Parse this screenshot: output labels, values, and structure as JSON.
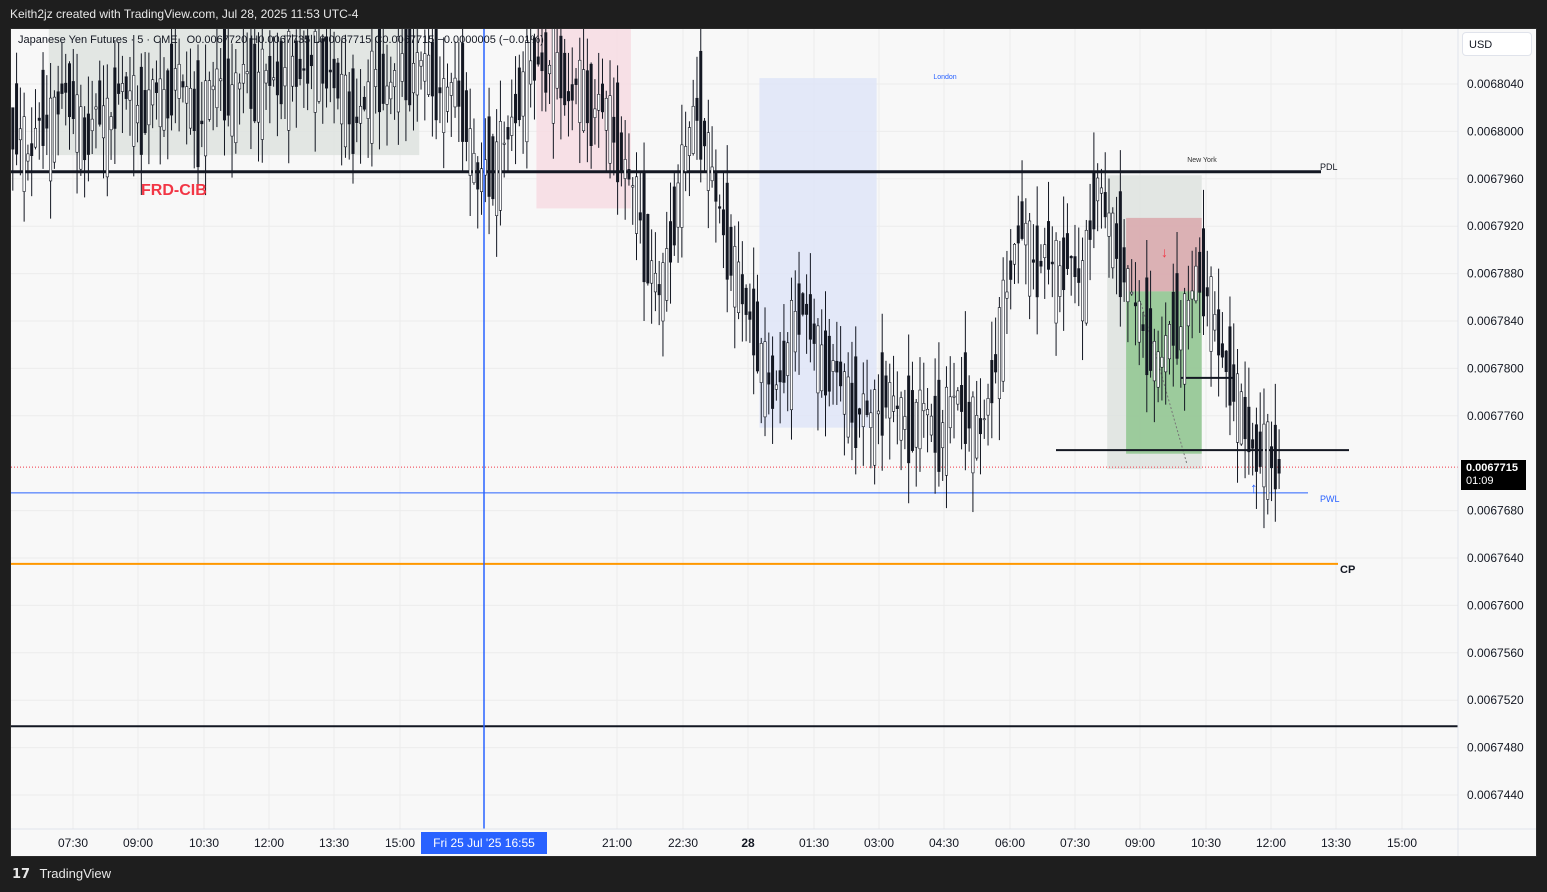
{
  "header": {
    "title": "Keith2jz created with TradingView.com, Jul 28, 2025 11:53 UTC-4"
  },
  "footer": {
    "brand": "TradingView"
  },
  "toolbar": {
    "currency": "USD"
  },
  "legend": {
    "symbol": "Japanese Yen Futures · 5 · CME",
    "ohlc": "O0.0067720 H0.0067735 L0.0067715 C0.0067715 −0.0000005 (−0.01%)"
  },
  "annotations": {
    "frd_label": "FRD-CIB",
    "london_label": "London",
    "newyork_label": "New York",
    "pdl_label": "PDL",
    "pwl_label": "PWL",
    "cp_label": "CP"
  },
  "price_tag": {
    "price": "0.0067715",
    "countdown": "01:09"
  },
  "crosshair_time": "Fri 25 Jul '25   16:55",
  "colors": {
    "pink_zone": "#f6dde3",
    "gray_zone": "#dfe3e0",
    "blue_zone": "#e0e6f7",
    "stop_zone": "#d9a7ab",
    "target_zone": "#8fc68f",
    "cp_line": "#ff9800",
    "pwl_line": "#2962ff",
    "frd_text": "#f23645"
  },
  "chart_data": {
    "type": "candlestick",
    "symbol": "Japanese Yen Futures",
    "interval": "5",
    "exchange": "CME",
    "ylim": [
      0.00674,
      0.006808
    ],
    "y_ticks": [
      "0.0068040",
      "0.0068000",
      "0.0067960",
      "0.0067920",
      "0.0067880",
      "0.0067840",
      "0.0067800",
      "0.0067760",
      "0.0067680",
      "0.0067640",
      "0.0067600",
      "0.0067560",
      "0.0067520",
      "0.0067480",
      "0.0067440"
    ],
    "x_ticks": [
      "07:30",
      "09:00",
      "10:30",
      "12:00",
      "13:30",
      "15:00",
      "21:00",
      "22:30",
      "28",
      "01:30",
      "03:00",
      "04:30",
      "06:00",
      "07:30",
      "09:00",
      "10:30",
      "12:00",
      "13:30",
      "15:00"
    ],
    "last_price": 0.0067715,
    "levels": [
      {
        "name": "PDL",
        "price": 0.0067966
      },
      {
        "name": "PWL",
        "price": 0.0067695
      },
      {
        "name": "CP",
        "price": 0.0067635
      },
      {
        "name": "",
        "price": 0.0067498
      },
      {
        "name": "",
        "price": 0.0067731
      }
    ],
    "series_path": [
      [
        0,
        0.0067995
      ],
      [
        2,
        0.0068005
      ],
      [
        5,
        0.0067975
      ],
      [
        8,
        0.0068015
      ],
      [
        11,
        0.0068
      ],
      [
        14,
        0.006804
      ],
      [
        17,
        0.006802
      ],
      [
        20,
        0.0067985
      ],
      [
        23,
        0.0068025
      ],
      [
        26,
        0.0068
      ],
      [
        29,
        0.006804
      ],
      [
        32,
        0.006803
      ],
      [
        35,
        0.0068005
      ],
      [
        38,
        0.006804
      ],
      [
        41,
        0.006802
      ],
      [
        44,
        0.006805
      ],
      [
        47,
        0.006803
      ],
      [
        50,
        0.0068
      ],
      [
        53,
        0.0068035
      ],
      [
        56,
        0.0068045
      ],
      [
        59,
        0.006802
      ],
      [
        62,
        0.0068055
      ],
      [
        65,
        0.006803
      ],
      [
        68,
        0.006805
      ],
      [
        71,
        0.006804
      ],
      [
        74,
        0.0068055
      ],
      [
        77,
        0.006805
      ],
      [
        80,
        0.006806
      ],
      [
        85,
        0.006805
      ],
      [
        88,
        0.006803
      ],
      [
        91,
        0.0068005
      ],
      [
        94,
        0.0068025
      ],
      [
        97,
        0.006805
      ],
      [
        100,
        0.006803
      ],
      [
        103,
        0.006806
      ],
      [
        106,
        0.0068045
      ],
      [
        109,
        0.006806
      ],
      [
        112,
        0.0068045
      ],
      [
        115,
        0.0068025
      ],
      [
        117,
        0.006804
      ],
      [
        120,
        0.006802
      ],
      [
        122,
        0.006798
      ],
      [
        124,
        0.0067955
      ],
      [
        126,
        0.0067975
      ],
      [
        128,
        0.006796
      ],
      [
        130,
        0.0067985
      ],
      [
        132,
        0.0068
      ],
      [
        134,
        0.006802
      ],
      [
        136,
        0.006804
      ],
      [
        138,
        0.0068055
      ],
      [
        140,
        0.006806
      ],
      [
        142,
        0.006805
      ],
      [
        144,
        0.006806
      ],
      [
        146,
        0.0068045
      ],
      [
        148,
        0.0068025
      ],
      [
        150,
        0.0068045
      ],
      [
        152,
        0.006803
      ],
      [
        154,
        0.006801
      ],
      [
        156,
        0.006803
      ],
      [
        158,
        0.0068015
      ],
      [
        160,
        0.0067995
      ],
      [
        162,
        0.0067975
      ],
      [
        164,
        0.006796
      ],
      [
        166,
        0.006794
      ],
      [
        168,
        0.00679
      ],
      [
        170,
        0.006788
      ],
      [
        172,
        0.0067862
      ],
      [
        174,
        0.006789
      ],
      [
        176,
        0.006793
      ],
      [
        178,
        0.006797
      ],
      [
        180,
        0.0068
      ],
      [
        182,
        0.006802
      ],
      [
        184,
        0.006799
      ],
      [
        186,
        0.006796
      ],
      [
        188,
        0.006793
      ],
      [
        190,
        0.00679
      ],
      [
        192,
        0.006788
      ],
      [
        194,
        0.006786
      ],
      [
        196,
        0.006784
      ],
      [
        198,
        0.0067815
      ],
      [
        200,
        0.0067795
      ],
      [
        202,
        0.006778
      ],
      [
        204,
        0.0067795
      ],
      [
        206,
        0.0067815
      ],
      [
        208,
        0.006784
      ],
      [
        210,
        0.0067855
      ],
      [
        212,
        0.0067835
      ],
      [
        214,
        0.006781
      ],
      [
        216,
        0.0067795
      ],
      [
        218,
        0.0067805
      ],
      [
        220,
        0.006779
      ],
      [
        222,
        0.006777
      ],
      [
        224,
        0.006776
      ],
      [
        226,
        0.006777
      ],
      [
        228,
        0.0067755
      ],
      [
        230,
        0.0067765
      ],
      [
        232,
        0.006778
      ],
      [
        234,
        0.006777
      ],
      [
        236,
        0.006776
      ],
      [
        238,
        0.0067745
      ],
      [
        240,
        0.006776
      ],
      [
        242,
        0.006777
      ],
      [
        244,
        0.006775
      ],
      [
        246,
        0.006774
      ],
      [
        248,
        0.006776
      ],
      [
        250,
        0.006778
      ],
      [
        252,
        0.006777
      ],
      [
        254,
        0.0067755
      ],
      [
        256,
        0.0067745
      ],
      [
        258,
        0.006776
      ],
      [
        260,
        0.006779
      ],
      [
        262,
        0.006783
      ],
      [
        264,
        0.006787
      ],
      [
        266,
        0.0067905
      ],
      [
        268,
        0.0067925
      ],
      [
        270,
        0.0067895
      ],
      [
        272,
        0.006788
      ],
      [
        274,
        0.0067905
      ],
      [
        276,
        0.0067885
      ],
      [
        278,
        0.0067875
      ],
      [
        280,
        0.00679
      ],
      [
        282,
        0.006788
      ],
      [
        284,
        0.006787
      ],
      [
        286,
        0.0067925
      ],
      [
        288,
        0.006796
      ],
      [
        290,
        0.006793
      ],
      [
        292,
        0.006791
      ],
      [
        294,
        0.006789
      ],
      [
        296,
        0.006787
      ],
      [
        298,
        0.006785
      ],
      [
        300,
        0.006783
      ],
      [
        302,
        0.0067815
      ],
      [
        304,
        0.00678
      ],
      [
        306,
        0.006782
      ],
      [
        308,
        0.006784
      ],
      [
        310,
        0.0067825
      ],
      [
        312,
        0.0067855
      ],
      [
        314,
        0.006788
      ],
      [
        316,
        0.006787
      ],
      [
        318,
        0.006785
      ],
      [
        320,
        0.006782
      ],
      [
        322,
        0.00678
      ],
      [
        324,
        0.006778
      ],
      [
        326,
        0.006776
      ],
      [
        328,
        0.006774
      ],
      [
        330,
        0.0067725
      ],
      [
        332,
        0.0067735
      ],
      [
        334,
        0.006772
      ],
      [
        336,
        0.0067715
      ]
    ],
    "zones": [
      {
        "from": 10,
        "to": 108,
        "top": 0.006812,
        "bottom": 0.006798
      },
      {
        "from": 139,
        "to": 164,
        "top": 0.006812,
        "bottom": 0.0067935
      },
      {
        "from": 198,
        "to": 229,
        "top": 0.0068045,
        "bottom": 0.006775
      },
      {
        "from": 290,
        "to": 315,
        "top": 0.0067963,
        "bottom": 0.0067715
      }
    ],
    "trade": {
      "from": 295,
      "to": 315,
      "entry": 0.0067865,
      "stop": 0.0067927,
      "target": 0.0067728
    }
  }
}
